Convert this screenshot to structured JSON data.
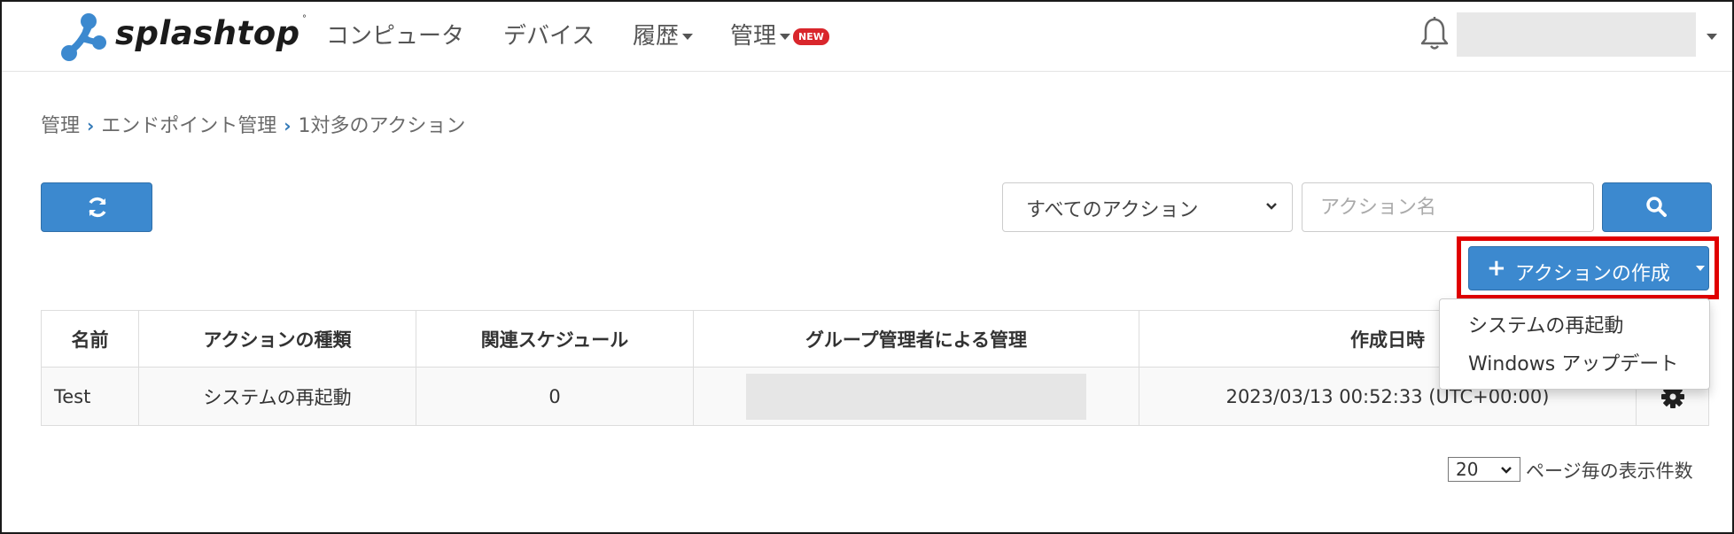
{
  "header": {
    "brand": "splashtop",
    "brand_mark": "°",
    "nav": {
      "computers": "コンピュータ",
      "devices": "デバイス",
      "history": "履歴",
      "manage": "管理",
      "new_badge": "NEW"
    }
  },
  "breadcrumb": {
    "item1": "管理",
    "item2": "エンドポイント管理",
    "item3": "1対多のアクション"
  },
  "toolbar": {
    "filter_selected": "すべてのアクション",
    "search_placeholder": "アクション名",
    "create_button": "アクションの作成"
  },
  "table": {
    "headers": {
      "name": "名前",
      "type": "アクションの種類",
      "schedule": "関連スケジュール",
      "group_admin": "グループ管理者による管理",
      "created": "作成日時"
    },
    "rows": [
      {
        "name": "Test",
        "type": "システムの再起動",
        "schedule": "0",
        "created": "2023/03/13 00:52:33 (UTC+00:00)"
      }
    ]
  },
  "create_menu": {
    "items": [
      "システムの再起動",
      "Windows アップデート"
    ]
  },
  "pagination": {
    "per_page": "20",
    "per_page_label": "ページ毎の表示件数"
  },
  "colors": {
    "primary": "#3c89cf",
    "highlight": "#e00000",
    "badge": "#d9262c"
  }
}
